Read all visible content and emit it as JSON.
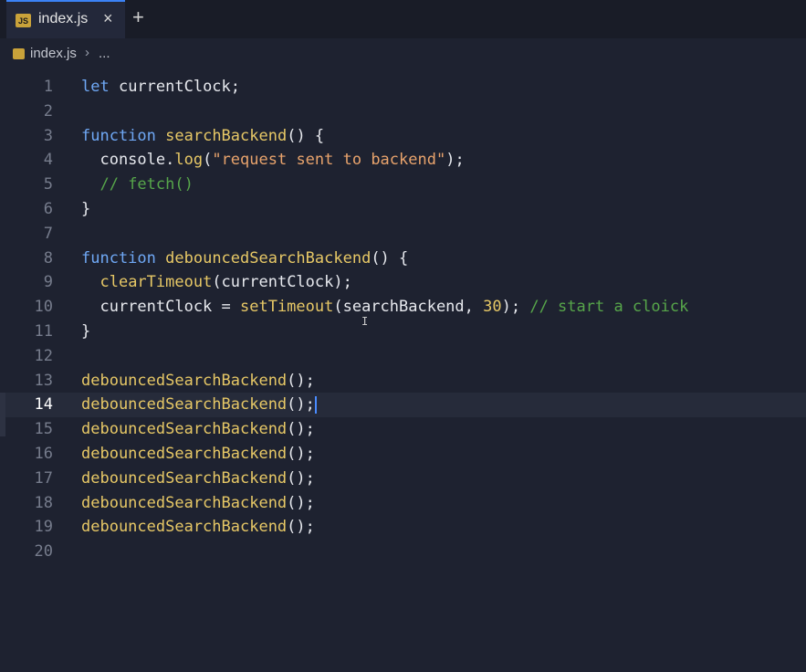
{
  "tabs": [
    {
      "icon": "JS",
      "label": "index.js",
      "close": "×",
      "active": true
    }
  ],
  "tab_add": "+",
  "breadcrumb": {
    "file": "index.js",
    "separator": "›",
    "more": "..."
  },
  "editor": {
    "active_line": 14,
    "lines": [
      {
        "n": "1",
        "tokens": [
          {
            "t": "let",
            "c": "kw"
          },
          {
            "t": " currentClock;",
            "c": ""
          }
        ]
      },
      {
        "n": "2",
        "tokens": []
      },
      {
        "n": "3",
        "tokens": [
          {
            "t": "function",
            "c": "kw"
          },
          {
            "t": " ",
            "c": ""
          },
          {
            "t": "searchBackend",
            "c": "fn"
          },
          {
            "t": "() {",
            "c": ""
          }
        ]
      },
      {
        "n": "4",
        "tokens": [
          {
            "t": "  console.",
            "c": ""
          },
          {
            "t": "log",
            "c": "fn"
          },
          {
            "t": "(",
            "c": ""
          },
          {
            "t": "\"request sent to backend\"",
            "c": "str"
          },
          {
            "t": ");",
            "c": ""
          }
        ]
      },
      {
        "n": "5",
        "tokens": [
          {
            "t": "  ",
            "c": ""
          },
          {
            "t": "// fetch()",
            "c": "cmt"
          }
        ]
      },
      {
        "n": "6",
        "tokens": [
          {
            "t": "}",
            "c": ""
          }
        ]
      },
      {
        "n": "7",
        "tokens": []
      },
      {
        "n": "8",
        "tokens": [
          {
            "t": "function",
            "c": "kw"
          },
          {
            "t": " ",
            "c": ""
          },
          {
            "t": "debouncedSearchBackend",
            "c": "fn"
          },
          {
            "t": "() {",
            "c": ""
          }
        ]
      },
      {
        "n": "9",
        "tokens": [
          {
            "t": "  ",
            "c": ""
          },
          {
            "t": "clearTimeout",
            "c": "fn"
          },
          {
            "t": "(currentClock);",
            "c": ""
          }
        ]
      },
      {
        "n": "10",
        "tokens": [
          {
            "t": "  currentClock = ",
            "c": ""
          },
          {
            "t": "setTimeout",
            "c": "fn"
          },
          {
            "t": "(searchBackend, ",
            "c": ""
          },
          {
            "t": "30",
            "c": "num"
          },
          {
            "t": "); ",
            "c": ""
          },
          {
            "t": "// start a cloick",
            "c": "cmt"
          }
        ]
      },
      {
        "n": "11",
        "tokens": [
          {
            "t": "}",
            "c": ""
          }
        ]
      },
      {
        "n": "12",
        "tokens": []
      },
      {
        "n": "13",
        "tokens": [
          {
            "t": "debouncedSearchBackend",
            "c": "fn"
          },
          {
            "t": "();",
            "c": ""
          }
        ]
      },
      {
        "n": "14",
        "tokens": [
          {
            "t": "debouncedSearchBackend",
            "c": "fn"
          },
          {
            "t": "();",
            "c": ""
          }
        ]
      },
      {
        "n": "15",
        "tokens": [
          {
            "t": "debouncedSearchBackend",
            "c": "fn"
          },
          {
            "t": "();",
            "c": ""
          }
        ]
      },
      {
        "n": "16",
        "tokens": [
          {
            "t": "debouncedSearchBackend",
            "c": "fn"
          },
          {
            "t": "();",
            "c": ""
          }
        ]
      },
      {
        "n": "17",
        "tokens": [
          {
            "t": "debouncedSearchBackend",
            "c": "fn"
          },
          {
            "t": "();",
            "c": ""
          }
        ]
      },
      {
        "n": "18",
        "tokens": [
          {
            "t": "debouncedSearchBackend",
            "c": "fn"
          },
          {
            "t": "();",
            "c": ""
          }
        ]
      },
      {
        "n": "19",
        "tokens": [
          {
            "t": "debouncedSearchBackend",
            "c": "fn"
          },
          {
            "t": "();",
            "c": ""
          }
        ]
      },
      {
        "n": "20",
        "tokens": []
      }
    ]
  },
  "colors": {
    "editor_bg": "#1e2230",
    "keyword": "#6fa8f5",
    "function": "#e7c866",
    "string": "#e8a36c",
    "comment": "#57a64a",
    "cursor": "#4a8cff",
    "tab_accent": "#3b82f6"
  }
}
